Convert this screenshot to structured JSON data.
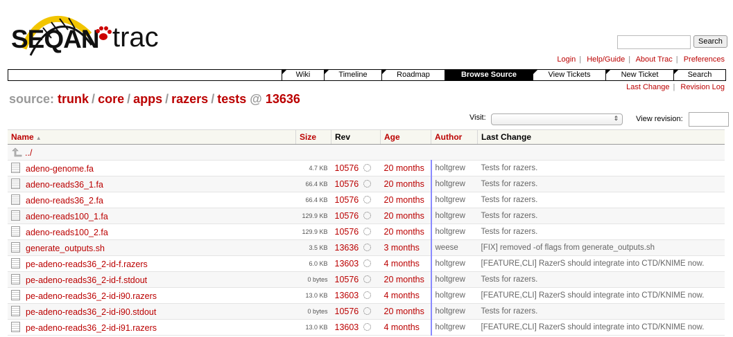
{
  "logo": {
    "text_seqan": "SEQAN",
    "text_trac": "trac"
  },
  "search": {
    "button_label": "Search",
    "placeholder": ""
  },
  "metanav": [
    "Login",
    "Help/Guide",
    "About Trac",
    "Preferences"
  ],
  "mainnav": [
    {
      "label": "Wiki",
      "active": false
    },
    {
      "label": "Timeline",
      "active": false
    },
    {
      "label": "Roadmap",
      "active": false
    },
    {
      "label": "Browse Source",
      "active": true
    },
    {
      "label": "View Tickets",
      "active": false
    },
    {
      "label": "New Ticket",
      "active": false
    },
    {
      "label": "Search",
      "active": false
    }
  ],
  "ctxtnav": [
    "Last Change",
    "Revision Log"
  ],
  "path": {
    "prefix": "source:",
    "segments": [
      "trunk",
      "core",
      "apps",
      "razers",
      "tests"
    ],
    "at": "@",
    "revision": "13636"
  },
  "visit": {
    "label": "Visit:",
    "selected": ""
  },
  "view_revision": {
    "label": "View revision:",
    "value": ""
  },
  "table": {
    "headers": {
      "name": "Name",
      "size": "Size",
      "rev": "Rev",
      "age": "Age",
      "author": "Author",
      "change": "Last Change"
    },
    "parent": "../",
    "rows": [
      {
        "name": "adeno-genome.fa",
        "size": "4.7 KB",
        "rev": "10576",
        "age": "20 months",
        "author": "holtgrew",
        "change": "Tests for razers."
      },
      {
        "name": "adeno-reads36_1.fa",
        "size": "66.4 KB",
        "rev": "10576",
        "age": "20 months",
        "author": "holtgrew",
        "change": "Tests for razers."
      },
      {
        "name": "adeno-reads36_2.fa",
        "size": "66.4 KB",
        "rev": "10576",
        "age": "20 months",
        "author": "holtgrew",
        "change": "Tests for razers."
      },
      {
        "name": "adeno-reads100_1.fa",
        "size": "129.9 KB",
        "rev": "10576",
        "age": "20 months",
        "author": "holtgrew",
        "change": "Tests for razers."
      },
      {
        "name": "adeno-reads100_2.fa",
        "size": "129.9 KB",
        "rev": "10576",
        "age": "20 months",
        "author": "holtgrew",
        "change": "Tests for razers."
      },
      {
        "name": "generate_outputs.sh",
        "size": "3.5 KB",
        "rev": "13636",
        "age": "3 months",
        "author": "weese",
        "change": "[FIX] removed -of flags from generate_outputs.sh"
      },
      {
        "name": "pe-adeno-reads36_2-id-f.razers",
        "size": "6.0 KB",
        "rev": "13603",
        "age": "4 months",
        "author": "holtgrew",
        "change": "[FEATURE,CLI] RazerS should integrate into CTD/KNIME now."
      },
      {
        "name": "pe-adeno-reads36_2-id-f.stdout",
        "size": "0 bytes",
        "rev": "10576",
        "age": "20 months",
        "author": "holtgrew",
        "change": "Tests for razers."
      },
      {
        "name": "pe-adeno-reads36_2-id-i90.razers",
        "size": "13.0 KB",
        "rev": "13603",
        "age": "4 months",
        "author": "holtgrew",
        "change": "[FEATURE,CLI] RazerS should integrate into CTD/KNIME now."
      },
      {
        "name": "pe-adeno-reads36_2-id-i90.stdout",
        "size": "0 bytes",
        "rev": "10576",
        "age": "20 months",
        "author": "holtgrew",
        "change": "Tests for razers."
      },
      {
        "name": "pe-adeno-reads36_2-id-i91.razers",
        "size": "13.0 KB",
        "rev": "13603",
        "age": "4 months",
        "author": "holtgrew",
        "change": "[FEATURE,CLI] RazerS should integrate into CTD/KNIME now."
      }
    ]
  }
}
